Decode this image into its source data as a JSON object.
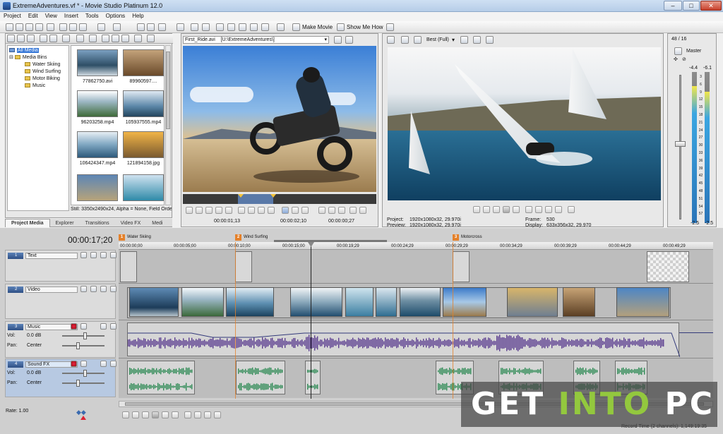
{
  "window": {
    "title": "ExtremeAdventures.vf * - Movie Studio Platinum 12.0",
    "min": "–",
    "max": "□",
    "close": "✕"
  },
  "menu": [
    "Project",
    "Edit",
    "View",
    "Insert",
    "Tools",
    "Options",
    "Help"
  ],
  "toolbar": {
    "make_movie": "Make Movie",
    "show_me_how": "Show Me How"
  },
  "explorer": {
    "tree": {
      "all_media": "All Media",
      "media_bins": "Media Bins",
      "bins": [
        "Water Skiing",
        "Wind Surfing",
        "Motor Biking",
        "Music"
      ]
    },
    "thumbs": [
      {
        "name": "77862750.avi"
      },
      {
        "name": "89960597...."
      },
      {
        "name": "96203258.mp4"
      },
      {
        "name": "105937555.mp4"
      },
      {
        "name": "106424347.mp4"
      },
      {
        "name": "121894158.jpg"
      },
      {
        "name": ""
      },
      {
        "name": ""
      }
    ],
    "status": "Still: 3350x2490x24, Alpha = None, Field Order ="
  },
  "window_tabs": [
    "Project Media",
    "Explorer",
    "Transitions",
    "Video FX",
    "Medi"
  ],
  "trimmer": {
    "file": "First_Ride.avi",
    "path": "[U:\\ExtremeAdventures\\]",
    "time_in": "00:00:01;13",
    "time_len": "00:00:02;10",
    "time_out": "00:00:00;27"
  },
  "preview": {
    "quality": "Best (Full)",
    "project_label": "Project:",
    "project_value": "1920x1080x32, 29.970i",
    "preview_label": "Preview:",
    "preview_value": "1920x1080x32, 29.970i",
    "frame_label": "Frame:",
    "frame_value": "530",
    "display_label": "Display:",
    "display_value": "633x356x32, 29.970"
  },
  "mixer": {
    "counter": "48 / 16",
    "master": "Master",
    "left_db": "-4.4",
    "right_db": "-6.1",
    "bottom_left": "-2.5",
    "bottom_right": "-2.5",
    "scale": [
      "3",
      "6",
      "9",
      "12",
      "15",
      "18",
      "21",
      "24",
      "27",
      "30",
      "33",
      "36",
      "39",
      "42",
      "45",
      "48",
      "51",
      "54",
      "57"
    ]
  },
  "timeline": {
    "timecode": "00:00:17;20",
    "markers": [
      {
        "num": "1",
        "label": "Water Skiing"
      },
      {
        "num": "2",
        "label": "Wind Surfing"
      },
      {
        "num": "3",
        "label": "Motorcross"
      }
    ],
    "ruler": [
      "00:00:00;00",
      "00:00:05;00",
      "00:00:10;00",
      "00:00:15;00",
      "00:00:19;29",
      "00:00:24;29",
      "00:00:29;29",
      "00:00:34;29",
      "00:00:39;29",
      "00:00:44;29",
      "00:00:49;29"
    ],
    "tracks": [
      {
        "num": "1",
        "name": "Text"
      },
      {
        "num": "2",
        "name": "Video"
      },
      {
        "num": "3",
        "name": "Music",
        "vol_label": "Vol:",
        "vol_value": "0.0 dB",
        "pan_label": "Pan:",
        "pan_value": "Center"
      },
      {
        "num": "4",
        "name": "Sound FX",
        "vol_label": "Vol:",
        "vol_value": "0.0 dB",
        "pan_label": "Pan:",
        "pan_value": "Center"
      }
    ],
    "rate": "Rate: 1.00",
    "record_time": "Record Time (2 channels): 1,149:19:35"
  },
  "watermark": {
    "part1": "GET ",
    "part2": "INTO",
    "part3": " PC"
  },
  "colors": {
    "accent": "#f2a629",
    "marker": "#e4812b",
    "waveform": "#5b3d8f",
    "sfx_wave": "#2f8a55",
    "watermark_green": "#93c83e"
  }
}
